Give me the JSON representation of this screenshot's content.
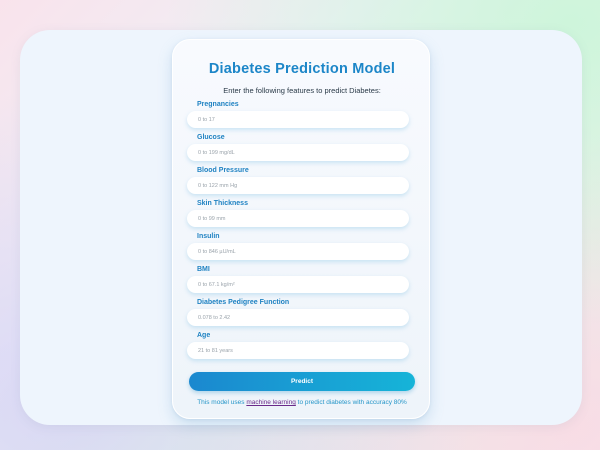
{
  "form": {
    "title": "Diabetes Prediction Model",
    "subtitle": "Enter the following features to predict Diabetes:",
    "fields": [
      {
        "label": "Pregnancies",
        "placeholder": "0 to 17",
        "value": ""
      },
      {
        "label": "Glucose",
        "placeholder": "0 to 199 mg/dL",
        "value": ""
      },
      {
        "label": "Blood Pressure",
        "placeholder": "0 to 122 mm Hg",
        "value": ""
      },
      {
        "label": "Skin Thickness",
        "placeholder": "0 to 99 mm",
        "value": ""
      },
      {
        "label": "Insulin",
        "placeholder": "0 to 846 µU/mL",
        "value": ""
      },
      {
        "label": "BMI",
        "placeholder": "0 to 67.1 kg/m²",
        "value": ""
      },
      {
        "label": "Diabetes Pedigree Function",
        "placeholder": "0.078 to 2.42",
        "value": ""
      },
      {
        "label": "Age",
        "placeholder": "21 to 81 years",
        "value": ""
      }
    ],
    "submit_label": "Predict",
    "footer": {
      "prefix": "This model uses ",
      "link_text": "machine learning",
      "suffix": " to predict diabetes with accuracy 80%"
    }
  },
  "colors": {
    "accent": "#1c86c8",
    "button_gradient_start": "#1b88cf",
    "button_gradient_end": "#16b4d8",
    "link": "#6a2a8a"
  }
}
